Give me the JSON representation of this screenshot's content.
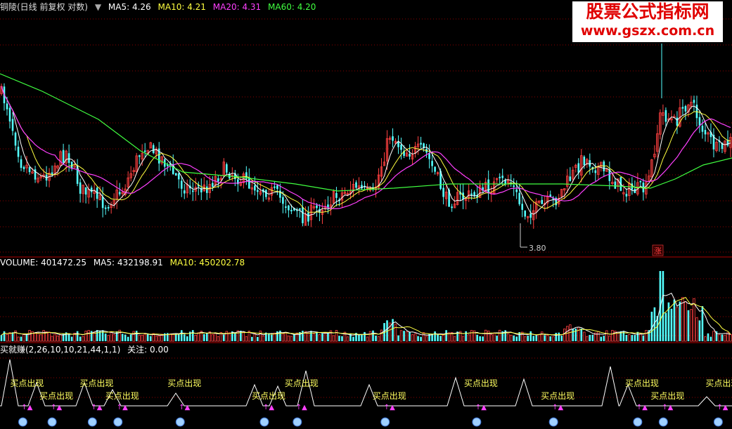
{
  "main_header": {
    "title": "铜陵(日线 前复权 对数)",
    "ma5": "MA5: 4.26",
    "ma10": "MA10: 4.21",
    "ma20": "MA20: 4.31",
    "ma60": "MA60: 4.20"
  },
  "volume_header": {
    "label": "VOLUME: 401472.25",
    "ma5": "MA5: 432198.91",
    "ma10": "MA10: 450202.78"
  },
  "indicator_header": {
    "label": "买就赚(2,26,10,10,21,44,1,1)",
    "value": "关注: 0.00"
  },
  "watermark": {
    "line1": "股票公式指标网",
    "line2": "www.gszx.com.cn"
  },
  "colors": {
    "up": "#ff4040",
    "down": "#54ffff",
    "ma5": "#ffffff",
    "ma10": "#ffff40",
    "ma20": "#ff40ff",
    "ma60": "#40ff40",
    "grid": "#8b0000",
    "signal": "#ff40ff"
  },
  "chart_data": [
    {
      "type": "candlestick",
      "panel": "price",
      "low_marker": "3.80",
      "limit_up_marker": "涨",
      "series_labels": [
        "MA5",
        "MA10",
        "MA20",
        "MA60"
      ]
    },
    {
      "type": "bar",
      "panel": "volume",
      "series_labels": [
        "MA5",
        "MA10"
      ]
    },
    {
      "type": "line",
      "panel": "indicator",
      "signal_text": "买点出现",
      "signal_positions": [
        0.035,
        0.075,
        0.13,
        0.165,
        0.25,
        0.365,
        0.41,
        0.53,
        0.655,
        0.76,
        0.875,
        0.91,
        0.985
      ]
    }
  ]
}
